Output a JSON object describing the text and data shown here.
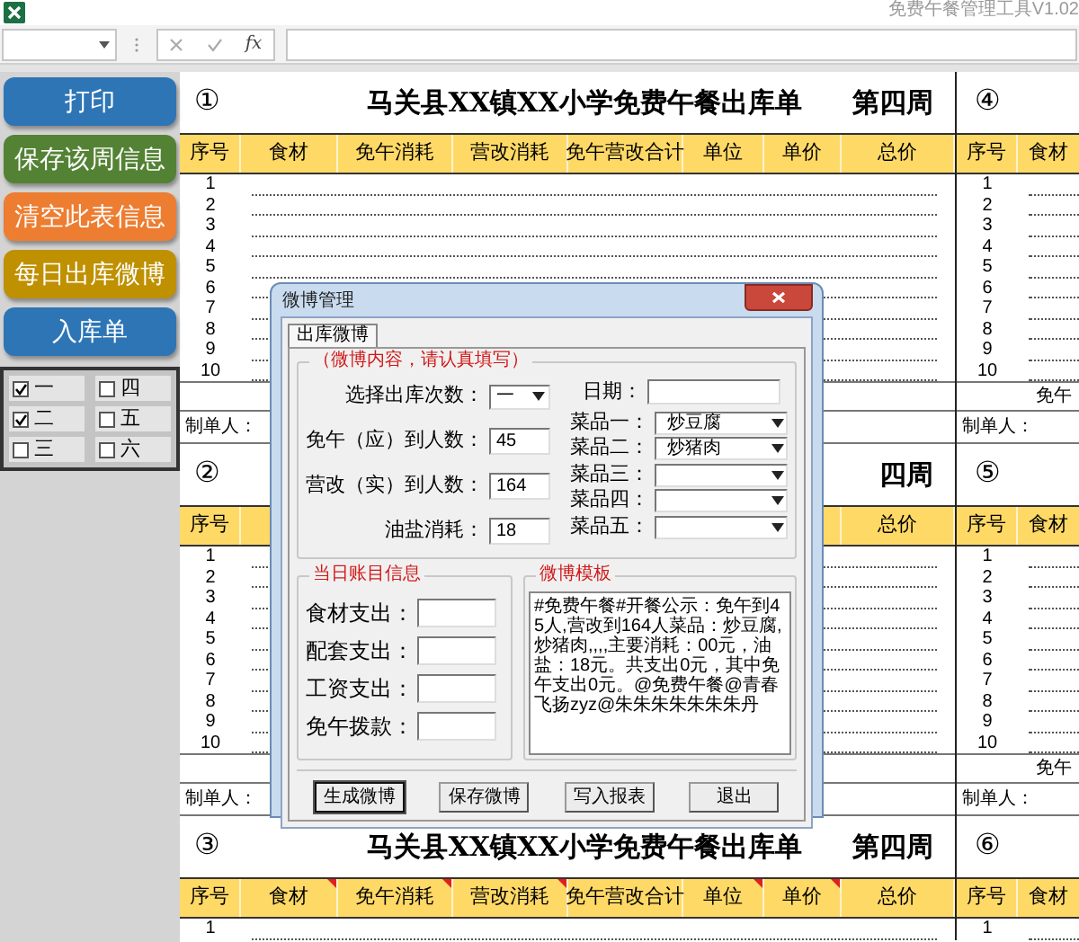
{
  "window": {
    "title": "免费午餐管理工具V1.02"
  },
  "formula_bar": {
    "function_label": "fx"
  },
  "side_buttons": [
    {
      "label": "打印",
      "color": "#2e75b6"
    },
    {
      "label": "保存该周信息",
      "color": "#548235"
    },
    {
      "label": "清空此表信息",
      "color": "#ed7d31"
    },
    {
      "label": "每日出库微博",
      "color": "#bf9000"
    },
    {
      "label": "入库单",
      "color": "#2e75b6"
    }
  ],
  "day_checkboxes": [
    {
      "label": "一",
      "checked": true
    },
    {
      "label": "四",
      "checked": false
    },
    {
      "label": "二",
      "checked": true
    },
    {
      "label": "五",
      "checked": false
    },
    {
      "label": "三",
      "checked": false
    },
    {
      "label": "六",
      "checked": false
    }
  ],
  "blocks": [
    {
      "left": {
        "number": "①",
        "title": "马关县XX镇XX小学免费午餐出库单",
        "week": "第四周",
        "maker": "制单人：",
        "headers": [
          {
            "label": "序号"
          },
          {
            "label": "食材"
          },
          {
            "label": "免午消耗"
          },
          {
            "label": "营改消耗"
          },
          {
            "label": "免午营改合计"
          },
          {
            "label": "单位"
          },
          {
            "label": "单价"
          },
          {
            "label": "总价"
          }
        ],
        "rows": [
          "1",
          "2",
          "3",
          "4",
          "5",
          "6",
          "7",
          "8",
          "9",
          "10"
        ]
      },
      "right": {
        "number": "④",
        "headers": [
          {
            "label": "序号"
          },
          {
            "label": "食材"
          }
        ],
        "rows": [
          "1",
          "2",
          "3",
          "4",
          "5",
          "6",
          "7",
          "8",
          "9",
          "10"
        ],
        "total_label": "免午",
        "maker": "制单人："
      }
    },
    {
      "left": {
        "number": "②",
        "week": "四周",
        "maker": "制单人：",
        "headers": [
          {
            "label": "序号"
          },
          {
            "label": "总价"
          }
        ],
        "rows": [
          "1",
          "2",
          "3",
          "4",
          "5",
          "6",
          "7",
          "8",
          "9",
          "10"
        ]
      },
      "right": {
        "number": "⑤",
        "headers": [
          {
            "label": "序号"
          },
          {
            "label": "食材"
          }
        ],
        "rows": [
          "1",
          "2",
          "3",
          "4",
          "5",
          "6",
          "7",
          "8",
          "9",
          "10"
        ],
        "total_label": "免午",
        "maker": "制单人："
      }
    },
    {
      "left": {
        "number": "③",
        "title": "马关县XX镇XX小学免费午餐出库单",
        "week": "第四周",
        "headers": [
          {
            "label": "序号",
            "comment": false
          },
          {
            "label": "食材",
            "comment": true
          },
          {
            "label": "免午消耗",
            "comment": true
          },
          {
            "label": "营改消耗",
            "comment": true
          },
          {
            "label": "免午营改合计",
            "comment": false
          },
          {
            "label": "单位",
            "comment": true
          },
          {
            "label": "单价",
            "comment": true
          },
          {
            "label": "总价",
            "comment": false
          }
        ],
        "rows": [
          "1"
        ]
      },
      "right": {
        "number": "⑥",
        "headers": [
          {
            "label": "序号"
          },
          {
            "label": "食材"
          }
        ],
        "rows": [
          "1"
        ]
      }
    }
  ],
  "dialog": {
    "title": "微博管理",
    "tabs": [
      {
        "label": "出库微博",
        "selected": true
      }
    ],
    "content_group": {
      "title": "（微博内容，请认真填写）",
      "fields": [
        {
          "label": "选择出库次数：",
          "kind": "dropdown",
          "value": "一"
        },
        {
          "label": "免午（应）到人数：",
          "kind": "text",
          "value": "45"
        },
        {
          "label": "营改（实）到人数：",
          "kind": "text",
          "value": "164"
        },
        {
          "label": "油盐消耗：",
          "kind": "text",
          "value": "18"
        }
      ],
      "date": {
        "label": "日期："
      },
      "dishes": [
        {
          "label": "菜品一：",
          "value": "炒豆腐"
        },
        {
          "label": "菜品二：",
          "value": "炒猪肉"
        },
        {
          "label": "菜品三："
        },
        {
          "label": "菜品四："
        },
        {
          "label": "菜品五："
        }
      ]
    },
    "account_group": {
      "title": "当日账目信息",
      "fields": [
        {
          "label": "食材支出："
        },
        {
          "label": "配套支出："
        },
        {
          "label": "工资支出："
        },
        {
          "label": "免午拨款："
        }
      ]
    },
    "template_group": {
      "title": "微博模板",
      "text": "#免费午餐#开餐公示：免午到45人,营改到164人菜品：炒豆腐,炒猪肉,,,,主要消耗：00元，油盐：18元。共支出0元，其中免午支出0元。@免费午餐@青春飞扬zyz@朱朱朱朱朱朱朱丹"
    },
    "buttons": [
      {
        "label": "生成微博",
        "default": true
      },
      {
        "label": "保存微博",
        "default": false
      },
      {
        "label": "写入报表",
        "default": false
      },
      {
        "label": "退出",
        "default": false
      }
    ]
  }
}
